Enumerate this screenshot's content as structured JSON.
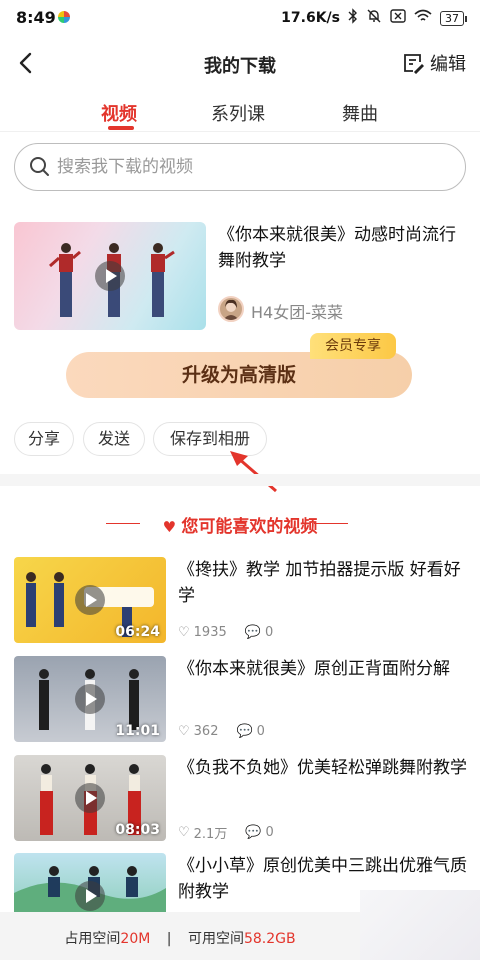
{
  "status_bar": {
    "time": "8:49",
    "net_speed": "17.6K/s",
    "battery": "37"
  },
  "header": {
    "title": "我的下载",
    "edit_label": "编辑"
  },
  "tabs": [
    {
      "label": "视频",
      "active": true
    },
    {
      "label": "系列课",
      "active": false
    },
    {
      "label": "舞曲",
      "active": false
    }
  ],
  "search": {
    "placeholder": "搜索我下载的视频"
  },
  "download": {
    "title": "《你本来就很美》动感时尚流行舞附教学",
    "author": "H4女团-菜菜",
    "upgrade_label": "升级为高清版",
    "vip_badge": "会员专享",
    "actions": [
      "分享",
      "发送",
      "保存到相册"
    ]
  },
  "recommend": {
    "heading": "您可能喜欢的视频",
    "items": [
      {
        "title": "《搀扶》教学 加节拍器提示版 好看好学",
        "duration": "06:24",
        "likes": "1935",
        "comments": "0"
      },
      {
        "title": "《你本来就很美》原创正背面附分解",
        "duration": "11:01",
        "likes": "362",
        "comments": "0"
      },
      {
        "title": "《负我不负她》优美轻松弹跳舞附教学",
        "duration": "08:03",
        "likes": "2.1万",
        "comments": "0"
      },
      {
        "title": "《小小草》原创优美中三跳出优雅气质附教学",
        "duration": "",
        "likes": "",
        "comments": ""
      }
    ]
  },
  "storage": {
    "used_label": "占用空间",
    "used_value": "20M",
    "sep": "|",
    "free_label": "可用空间",
    "free_value": "58.2GB"
  },
  "colors": {
    "accent": "#e3352c",
    "upgrade_bg": "#f6cfa9",
    "vip_badge": "#fcc845"
  }
}
